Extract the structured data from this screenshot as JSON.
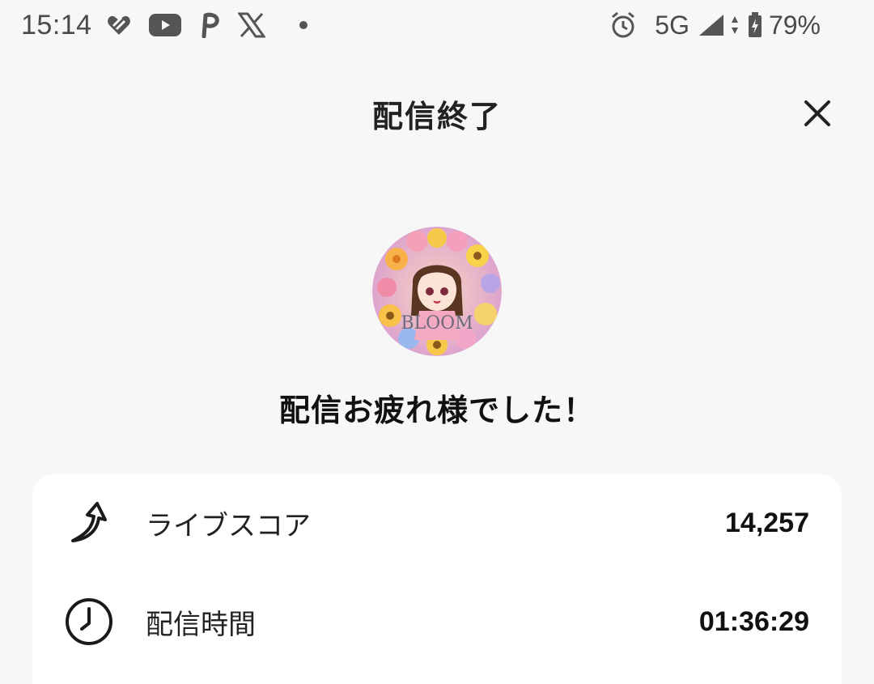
{
  "status_bar": {
    "time": "15:14",
    "network": "5G",
    "battery": "79%",
    "notification_icons": [
      "heart-stripe-icon",
      "youtube-icon",
      "p-app-icon",
      "x-app-icon"
    ]
  },
  "header": {
    "title": "配信終了"
  },
  "avatar": {
    "logo_text": "BLOOM"
  },
  "message": "配信お疲れ様でした！",
  "stats": [
    {
      "icon": "arrow-up-score-icon",
      "label": "ライブスコア",
      "value": "14,257"
    },
    {
      "icon": "clock-icon",
      "label": "配信時間",
      "value": "01:36:29"
    }
  ]
}
